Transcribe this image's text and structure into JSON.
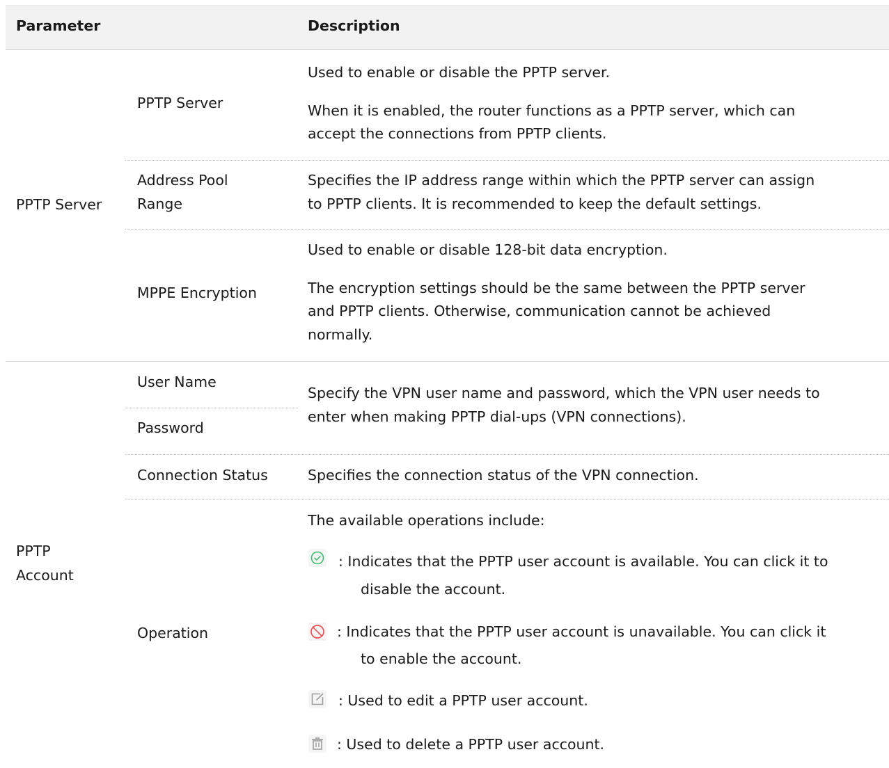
{
  "header": {
    "parameter": "Parameter",
    "description": "Description"
  },
  "server": {
    "group": "PPTP Server",
    "pptp_server": {
      "name": "PPTP Server",
      "desc1": "Used to enable or disable the PPTP server.",
      "desc2_line1": "When it is enabled, the router functions as a PPTP server, which can",
      "desc2_line2": "accept the connections from PPTP clients."
    },
    "address_pool": {
      "name_line1": "Address Pool",
      "name_line2": "Range",
      "desc_line1": "Specifies the IP address range within which the PPTP server can assign",
      "desc_line2": "to PPTP clients. It is recommended to keep the default settings."
    },
    "mppe": {
      "name": "MPPE Encryption",
      "desc1": "Used to enable or disable 128-bit data encryption.",
      "desc2_line1": "The encryption settings should be the same between the PPTP server",
      "desc2_line2": "and PPTP clients. Otherwise, communication cannot be achieved",
      "desc2_line3": "normally."
    }
  },
  "account": {
    "group_line1": "PPTP",
    "group_line2": "Account",
    "user_name": "User Name",
    "password": "Password",
    "credentials_desc_line1": "Specify the VPN user name and password, which the VPN user needs to",
    "credentials_desc_line2": "enter when making PPTP dial-ups (VPN connections).",
    "connection_status": {
      "name": "Connection Status",
      "desc": "Specifies the connection status of the VPN connection."
    },
    "operation": {
      "name": "Operation",
      "intro": "The available operations include:",
      "enabled_line1": ": Indicates that the PPTP user account is available. You can click it to",
      "enabled_line2": "disable the account.",
      "disabled_line1": ": Indicates that the PPTP user account is unavailable. You can click it",
      "disabled_line2": "to enable the account.",
      "edit": ": Used to edit a PPTP user account.",
      "delete": ": Used to delete a PPTP user account."
    }
  },
  "icons": {
    "enabled": "check-circle-icon",
    "disabled": "prohibited-icon",
    "edit": "edit-icon",
    "delete": "trash-icon",
    "green": "#3cbf6c",
    "red": "#f0504e",
    "gray": "#9a9a9a"
  }
}
